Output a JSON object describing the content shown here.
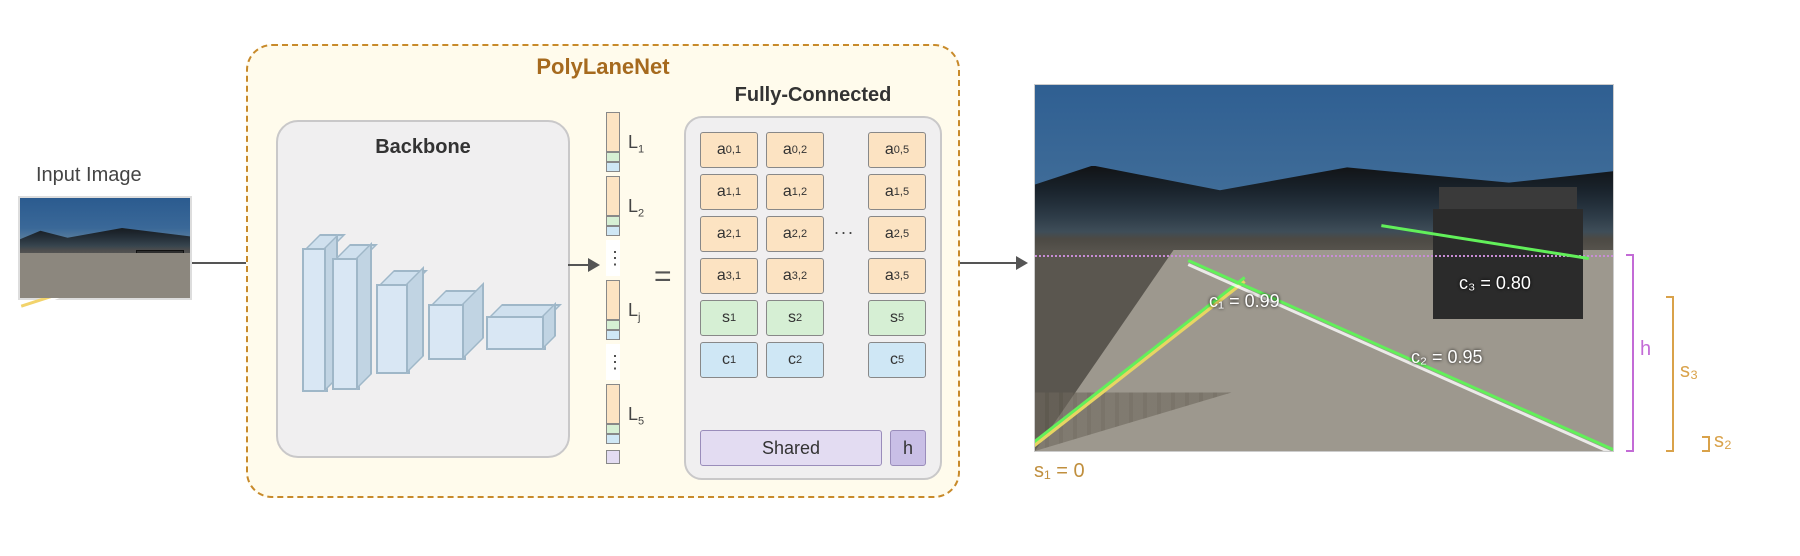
{
  "labels": {
    "input_image": "Input Image",
    "poly_title": "PolyLaneNet",
    "backbone": "Backbone",
    "fully_connected": "Fully-Connected",
    "equals": "=",
    "shared": "Shared",
    "shared_h": "h"
  },
  "feature_vector_groups": [
    "L",
    "L",
    "L",
    "L"
  ],
  "feature_vector_indices": [
    "1",
    "2",
    "j",
    "5"
  ],
  "feature_vector_ellipsis": "⋮",
  "fc": {
    "rows_a": [
      "a",
      "a",
      "a",
      "a"
    ],
    "row_a_first_idx": [
      "0",
      "1",
      "2",
      "3"
    ],
    "row_s": "s",
    "row_c": "c",
    "col_indices": [
      "1",
      "2",
      "5"
    ],
    "dots": "..."
  },
  "output": {
    "c1": "c₁ = 0.99",
    "c2": "c₂ = 0.95",
    "c3": "c₃ = 0.80",
    "h_label": "h",
    "s3_label": "s₃",
    "s2_label": "s₂",
    "s1_label": "s₁ = 0"
  },
  "colors": {
    "accent_brown": "#a66a1e",
    "lane_green": "#62f05a",
    "bracket_purple": "#c36bd6",
    "bracket_orange": "#d9a24a"
  }
}
